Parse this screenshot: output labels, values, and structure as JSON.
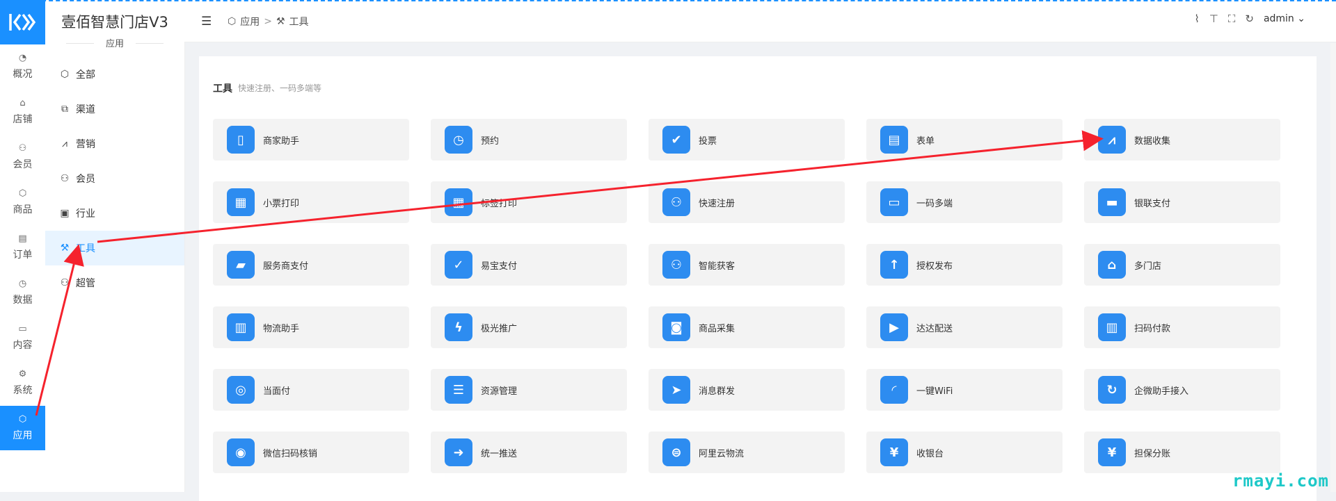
{
  "nav": {
    "items": [
      {
        "label": "概况",
        "icon": "dashboard-icon",
        "glyph": "◔"
      },
      {
        "label": "店铺",
        "icon": "store-icon",
        "glyph": "⌂"
      },
      {
        "label": "会员",
        "icon": "user-icon",
        "glyph": "⚇"
      },
      {
        "label": "商品",
        "icon": "box-icon",
        "glyph": "⬡"
      },
      {
        "label": "订单",
        "icon": "clipboard-icon",
        "glyph": "▤"
      },
      {
        "label": "数据",
        "icon": "pie-chart-icon",
        "glyph": "◷"
      },
      {
        "label": "内容",
        "icon": "folder-icon",
        "glyph": "▭"
      },
      {
        "label": "系统",
        "icon": "gear-icon",
        "glyph": "⚙"
      },
      {
        "label": "应用",
        "icon": "cube-icon",
        "glyph": "⬡",
        "active": true
      }
    ]
  },
  "brand": {
    "title": "壹佰智慧门店V3",
    "subtitle": "应用"
  },
  "subnav": {
    "items": [
      {
        "label": "全部",
        "icon": "cube-icon",
        "glyph": "⬡"
      },
      {
        "label": "渠道",
        "icon": "channel-icon",
        "glyph": "⧉"
      },
      {
        "label": "营销",
        "icon": "chart-line-icon",
        "glyph": "⩘"
      },
      {
        "label": "会员",
        "icon": "user-icon",
        "glyph": "⚇"
      },
      {
        "label": "行业",
        "icon": "briefcase-icon",
        "glyph": "▣"
      },
      {
        "label": "工具",
        "icon": "wrench-icon",
        "glyph": "⚒",
        "active": true
      },
      {
        "label": "超管",
        "icon": "admin-user-icon",
        "glyph": "⚇"
      }
    ]
  },
  "header": {
    "breadcrumb": {
      "root": "应用",
      "separator": ">",
      "current": "工具"
    },
    "user": "admin"
  },
  "section": {
    "title": "工具",
    "subtitle": "快速注册、一码多端等"
  },
  "tools": [
    {
      "label": "商家助手",
      "icon": "app-phone-icon",
      "glyph": "▯"
    },
    {
      "label": "预约",
      "icon": "clock-icon",
      "glyph": "◷"
    },
    {
      "label": "投票",
      "icon": "vote-icon",
      "glyph": "✔"
    },
    {
      "label": "表单",
      "icon": "form-icon",
      "glyph": "▤"
    },
    {
      "label": "数据收集",
      "icon": "monitor-chart-icon",
      "glyph": "⩘"
    },
    {
      "label": "小票打印",
      "icon": "printer-icon",
      "glyph": "▦"
    },
    {
      "label": "标签打印",
      "icon": "label-printer-icon",
      "glyph": "▦"
    },
    {
      "label": "快速注册",
      "icon": "user-add-icon",
      "glyph": "⚇"
    },
    {
      "label": "一码多端",
      "icon": "devices-icon",
      "glyph": "▭"
    },
    {
      "label": "银联支付",
      "icon": "card-icon",
      "glyph": "▬"
    },
    {
      "label": "服务商支付",
      "icon": "wallet-icon",
      "glyph": "▰"
    },
    {
      "label": "易宝支付",
      "icon": "chat-check-icon",
      "glyph": "✓"
    },
    {
      "label": "智能获客",
      "icon": "users-icon",
      "glyph": "⚇"
    },
    {
      "label": "授权发布",
      "icon": "upload-icon",
      "glyph": "↑"
    },
    {
      "label": "多门店",
      "icon": "shop-icon",
      "glyph": "⌂"
    },
    {
      "label": "物流助手",
      "icon": "barcode-search-icon",
      "glyph": "▥"
    },
    {
      "label": "极光推广",
      "icon": "bolt-icon",
      "glyph": "ϟ"
    },
    {
      "label": "商品采集",
      "icon": "bag-icon",
      "glyph": "◙"
    },
    {
      "label": "达达配送",
      "icon": "truck-icon",
      "glyph": "▶"
    },
    {
      "label": "扫码付款",
      "icon": "scan-barcode-icon",
      "glyph": "▥"
    },
    {
      "label": "当面付",
      "icon": "nfc-icon",
      "glyph": "◎"
    },
    {
      "label": "资源管理",
      "icon": "sliders-icon",
      "glyph": "☰"
    },
    {
      "label": "消息群发",
      "icon": "paper-plane-icon",
      "glyph": "➤"
    },
    {
      "label": "一键WiFi",
      "icon": "wifi-icon",
      "glyph": "◜"
    },
    {
      "label": "企微助手接入",
      "icon": "refresh-icon",
      "glyph": "↻"
    },
    {
      "label": "微信扫码核销",
      "icon": "wechat-scan-icon",
      "glyph": "◉"
    },
    {
      "label": "统一推送",
      "icon": "arrow-circle-icon",
      "glyph": "➜"
    },
    {
      "label": "阿里云物流",
      "icon": "aliyun-icon",
      "glyph": "⊜"
    },
    {
      "label": "收银台",
      "icon": "cashier-icon",
      "glyph": "¥"
    },
    {
      "label": "担保分账",
      "icon": "split-pay-icon",
      "glyph": "¥"
    }
  ],
  "watermark": "rmayi.com",
  "colors": {
    "accent": "#1a90ff",
    "tile_icon": "#2d8cf0",
    "annotation": "#f5222d"
  }
}
